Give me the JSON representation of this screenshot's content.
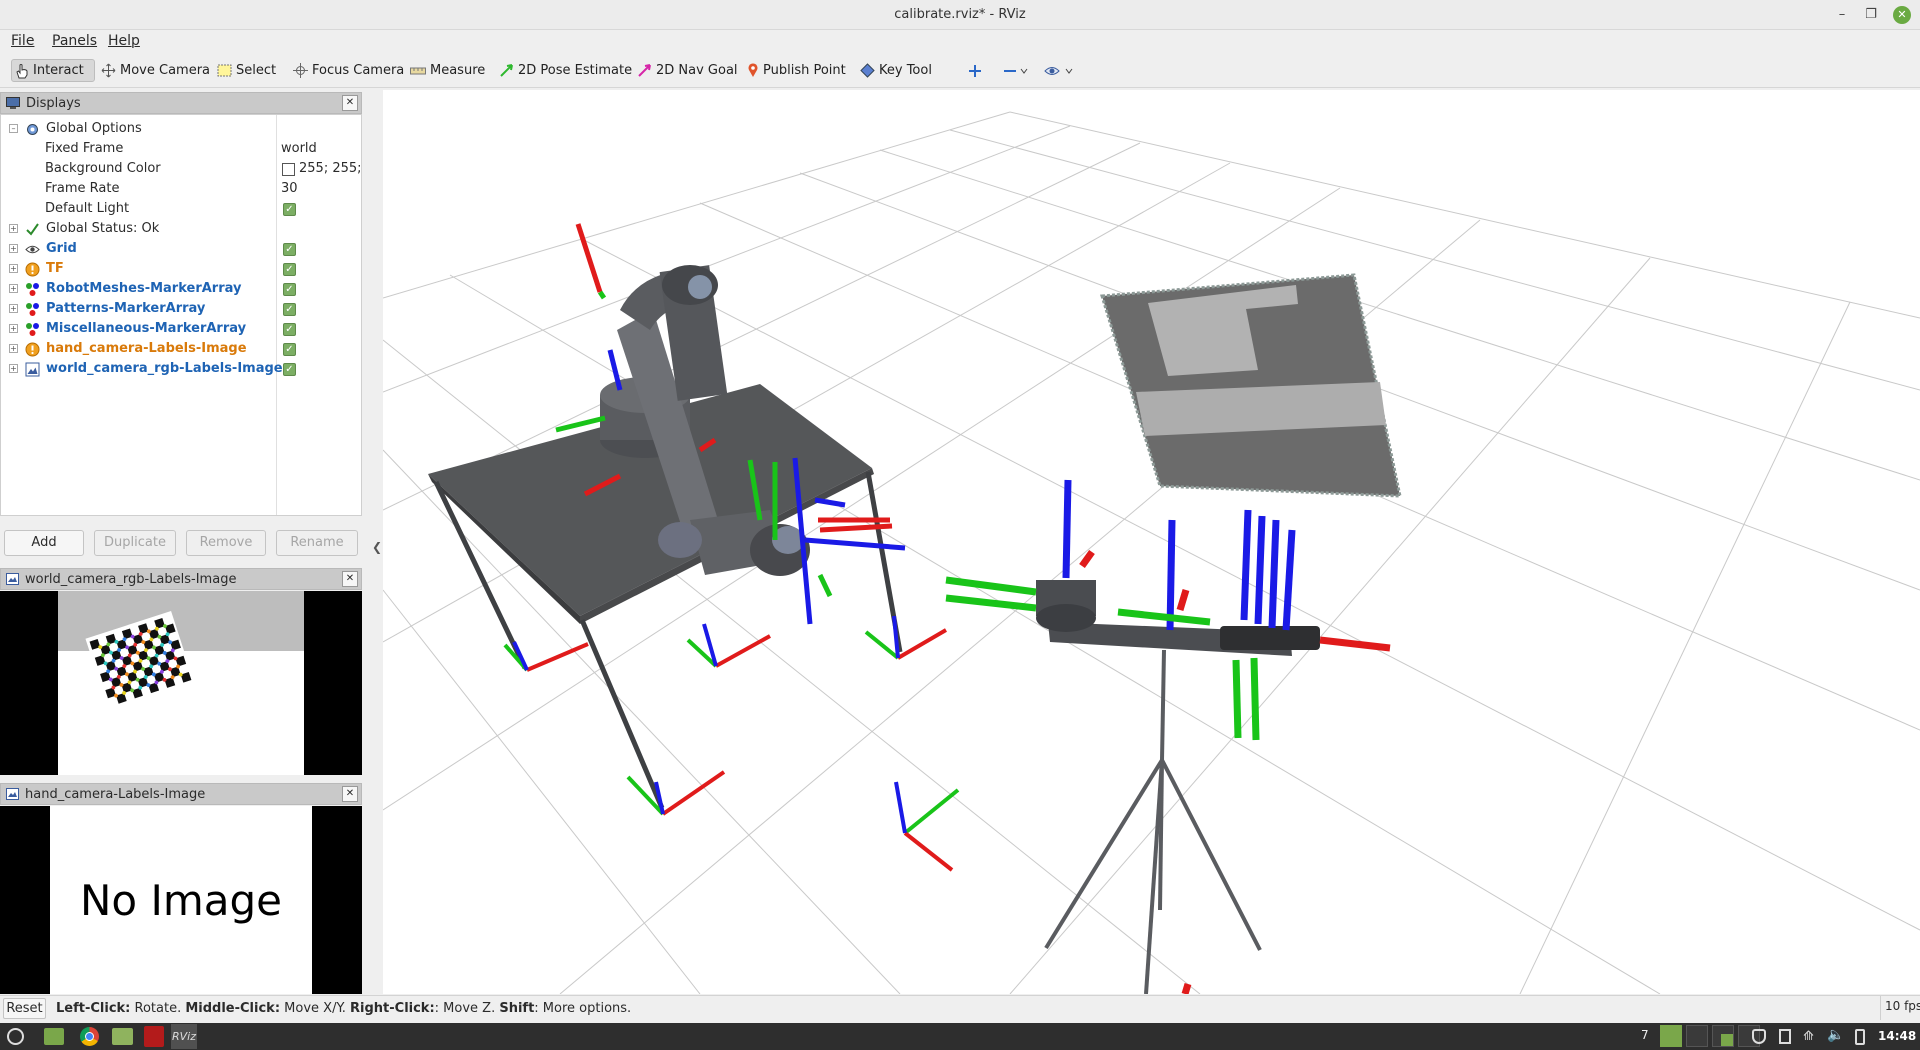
{
  "window": {
    "title": "calibrate.rviz* - RViz",
    "controls": [
      "minimize-icon",
      "maximize-icon",
      "close-icon"
    ]
  },
  "menubar": {
    "items": [
      "File",
      "Panels",
      "Help"
    ]
  },
  "toolbar": {
    "tools": [
      {
        "label": "Interact",
        "icon": "hand-pointer-icon",
        "active": true
      },
      {
        "label": "Move Camera",
        "icon": "move-arrows-icon",
        "active": false
      },
      {
        "label": "Select",
        "icon": "select-rectangle-icon",
        "active": false
      },
      {
        "label": "Focus Camera",
        "icon": "focus-crosshair-icon",
        "active": false
      },
      {
        "label": "Measure",
        "icon": "ruler-icon",
        "active": false
      },
      {
        "label": "2D Pose Estimate",
        "icon": "green-arrow-icon",
        "active": false
      },
      {
        "label": "2D Nav Goal",
        "icon": "pink-arrow-icon",
        "active": false
      },
      {
        "label": "Publish Point",
        "icon": "map-pin-icon",
        "active": false
      },
      {
        "label": "Key Tool",
        "icon": "diamond-icon",
        "active": false
      }
    ],
    "extra_icons": [
      "plus-icon",
      "minus-icon",
      "eye-icon"
    ]
  },
  "displays": {
    "title": "Displays",
    "rows": [
      {
        "label": "Global Options",
        "value": "",
        "check": false,
        "style": "normal",
        "expander": "-",
        "icon": "gear-icon"
      },
      {
        "label": "Fixed Frame",
        "value": "world",
        "check": false,
        "style": "normal",
        "expander": "",
        "icon": ""
      },
      {
        "label": "Background Color",
        "value": "255; 255;",
        "check": false,
        "style": "normal",
        "expander": "",
        "icon": "",
        "swatch": "#ffffff"
      },
      {
        "label": "Frame Rate",
        "value": "30",
        "check": false,
        "style": "normal",
        "expander": "",
        "icon": ""
      },
      {
        "label": "Default Light",
        "value": "",
        "check": true,
        "style": "normal",
        "expander": "",
        "icon": ""
      },
      {
        "label": "Global Status: Ok",
        "value": "",
        "check": false,
        "style": "normal",
        "expander": "+",
        "icon": "checkmark-icon"
      },
      {
        "label": "Grid",
        "value": "",
        "check": true,
        "style": "blue",
        "expander": "+",
        "icon": "grid-icon"
      },
      {
        "label": "TF",
        "value": "",
        "check": true,
        "style": "orange",
        "expander": "+",
        "icon": "warning-icon"
      },
      {
        "label": "RobotMeshes-MarkerArray",
        "value": "",
        "check": true,
        "style": "blue",
        "expander": "+",
        "icon": "marker-array-icon"
      },
      {
        "label": "Patterns-MarkerArray",
        "value": "",
        "check": true,
        "style": "blue",
        "expander": "+",
        "icon": "marker-array-icon"
      },
      {
        "label": "Miscellaneous-MarkerArray",
        "value": "",
        "check": true,
        "style": "blue",
        "expander": "+",
        "icon": "marker-array-icon"
      },
      {
        "label": "hand_camera-Labels-Image",
        "value": "",
        "check": true,
        "style": "orange",
        "expander": "+",
        "icon": "warning-icon"
      },
      {
        "label": "world_camera_rgb-Labels-Image",
        "value": "",
        "check": true,
        "style": "blue",
        "expander": "+",
        "icon": "image-icon"
      }
    ],
    "buttons": [
      "Add",
      "Duplicate",
      "Remove",
      "Rename"
    ]
  },
  "image_panels": [
    {
      "title": "world_camera_rgb-Labels-Image",
      "content": ""
    },
    {
      "title": "hand_camera-Labels-Image",
      "content": "No Image"
    }
  ],
  "status": {
    "reset": "Reset",
    "parts": [
      {
        "b": "Left-Click:",
        "t": " Rotate. "
      },
      {
        "b": "Middle-Click:",
        "t": " Move X/Y. "
      },
      {
        "b": "Right-Click:",
        "t": ": Move Z. "
      },
      {
        "b": "Shift",
        "t": ": More options."
      }
    ],
    "fps": "10 fps"
  },
  "taskbar": {
    "workspace": "7",
    "clock": "14:48",
    "apps": [
      "menu-icon",
      "files-icon",
      "chrome-icon",
      "folder-icon",
      "terminal-icon",
      "rviz-icon"
    ],
    "tray": [
      "shield-icon",
      "clipboard-icon",
      "network-icon",
      "volume-icon",
      "battery-icon"
    ]
  },
  "colors": {
    "x_axis": "#e01b1b",
    "y_axis": "#19c419",
    "z_axis": "#1a1ae6",
    "mesh": "#5a5c60"
  }
}
